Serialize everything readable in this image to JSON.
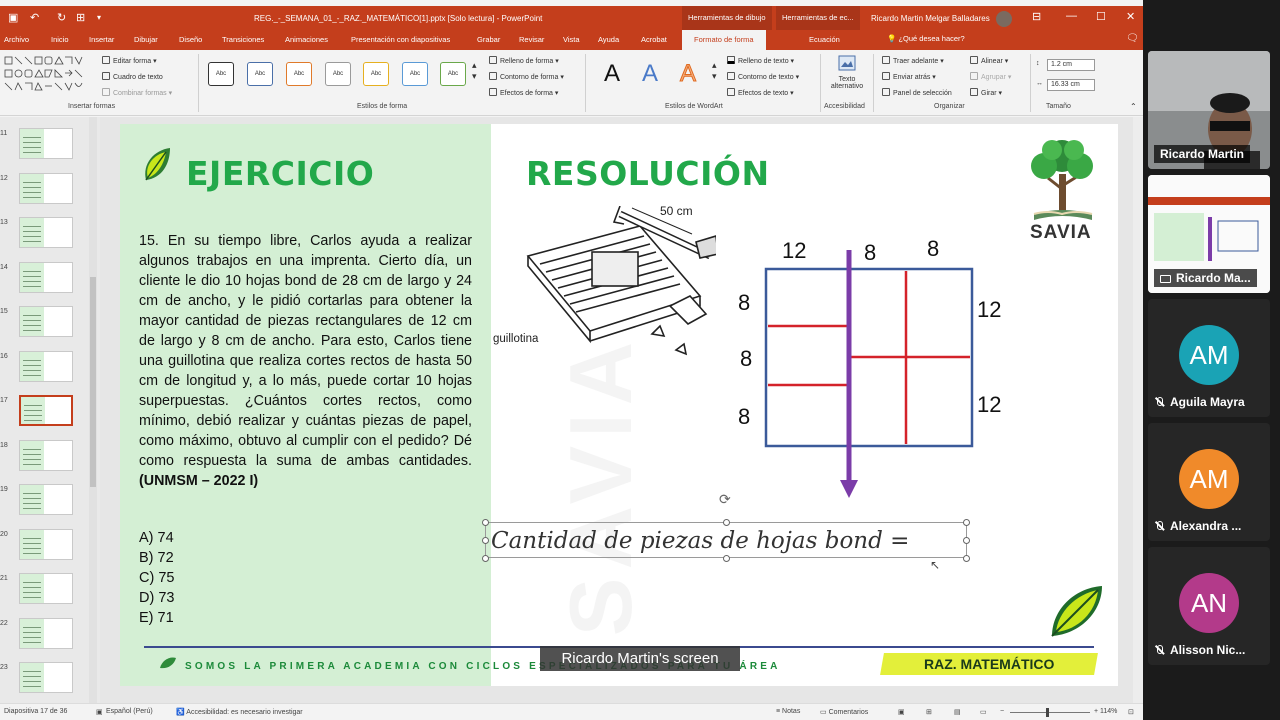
{
  "titlebar": {
    "doc_title": "REG._-_SEMANA_01_-_RAZ._MATEMÁTICO[1].pptx [Solo lectura]  -  PowerPoint",
    "context_tab_1": "Herramientas de dibujo",
    "context_tab_2": "Herramientas de ec...",
    "user": "Ricardo Martin Melgar Balladares",
    "quick_access": [
      "save-icon",
      "undo-icon",
      "redo-icon",
      "customize-icon"
    ]
  },
  "tabs": [
    "Archivo",
    "Inicio",
    "Insertar",
    "Dibujar",
    "Diseño",
    "Transiciones",
    "Animaciones",
    "Presentación con diapositivas",
    "Grabar",
    "Revisar",
    "Vista",
    "Ayuda",
    "Acrobat",
    "Formato de forma",
    "Ecuación"
  ],
  "active_tab": "Formato de forma",
  "tell_me": "¿Qué desea hacer?",
  "ribbon": {
    "insert_shapes": {
      "label": "Insertar formas",
      "edit_shape": "Editar forma",
      "text_box": "Cuadro de texto",
      "merge_shapes": "Combinar formas"
    },
    "shape_styles": {
      "label": "Estilos de forma",
      "sample": "Abc",
      "fill": "Relleno de forma",
      "outline": "Contorno de forma",
      "effects": "Efectos de forma"
    },
    "wordart_styles": {
      "label": "Estilos de WordArt",
      "letter": "A",
      "text_fill": "Relleno de texto",
      "text_outline": "Contorno de texto",
      "text_effects": "Efectos de texto"
    },
    "accessibility": {
      "label": "Accesibilidad",
      "alt_text_1": "Texto",
      "alt_text_2": "alternativo"
    },
    "arrange": {
      "label": "Organizar",
      "bring_forward": "Traer adelante",
      "send_backward": "Enviar atrás",
      "selection_pane": "Panel de selección",
      "align": "Alinear",
      "group": "Agrupar",
      "rotate": "Girar"
    },
    "size": {
      "label": "Tamaño",
      "height": "1.2 cm",
      "width": "16.33 cm"
    }
  },
  "thumbnails": [
    "11",
    "12",
    "13",
    "14",
    "15",
    "16",
    "17",
    "18",
    "19",
    "20",
    "21",
    "22",
    "23"
  ],
  "active_slide": "17",
  "slide": {
    "heading_left": "EJERCICIO",
    "heading_right": "RESOLUCIÓN",
    "problem_text": "15. En su tiempo libre, Carlos ayuda a realizar algunos trabajos en una imprenta. Cierto día, un cliente le dio 10 hojas bond de 28 cm de largo y 24 cm de ancho, y le pidió cortarlas para obtener la mayor cantidad de piezas rectangulares de 12 cm de largo y 8 cm de ancho. Para esto, Carlos tiene una guillotina que realiza cortes rectos de hasta 50 cm de longitud y, a lo más, puede cortar 10 hojas superpuestas. ¿Cuántos cortes rectos, como mínimo, debió realizar y cuántas piezas de papel, como máximo, obtuvo al cumplir con el pedido? Dé como respuesta la suma de ambas cantidades.",
    "problem_source": "(UNMSM – 2022 I)",
    "options": [
      "A) 74",
      "B) 72",
      "C) 75",
      "D) 73",
      "E) 71"
    ],
    "guillotine_label": "guillotina",
    "guillotine_dim": "50 cm",
    "brand": "SAVIA",
    "diagram": {
      "top": [
        "12",
        "8",
        "8"
      ],
      "left": [
        "8",
        "8",
        "8"
      ],
      "right": [
        "12",
        "12"
      ]
    },
    "formula": "Cantidad de piezas de hojas bond =",
    "footer": "SOMOS LA PRIMERA ACADEMIA CON CICLOS ESPECIALIZADOS PARA TU ÁREA",
    "badge": "RAZ. MATEMÁTICO"
  },
  "status": {
    "slide_info": "Diapositiva 17 de 36",
    "language": "Español (Perú)",
    "accessibility": "Accesibilidad: es necesario investigar",
    "notes": "Notas",
    "comments": "Comentarios",
    "zoom": "114%"
  },
  "share_caption": "Ricardo Martin's screen",
  "participants": [
    {
      "name": "Ricardo Martin",
      "kind": "video"
    },
    {
      "name": "Ricardo Ma...",
      "kind": "screen"
    },
    {
      "name": "Aguila Mayra",
      "initials": "AM",
      "color": "#1aa3b5"
    },
    {
      "name": "Alexandra ...",
      "initials": "AM",
      "color": "#f08a2a"
    },
    {
      "name": "Alisson Nic...",
      "initials": "AN",
      "color": "#b33a8a"
    }
  ],
  "colors": {
    "ppt_accent": "#c43e1c",
    "slide_green": "#22a84a",
    "slide_left_bg": "#d4efd4",
    "purple_cut": "#7b3ca8",
    "red_cut": "#d4222a",
    "grid_blue": "#3b5a9a"
  }
}
